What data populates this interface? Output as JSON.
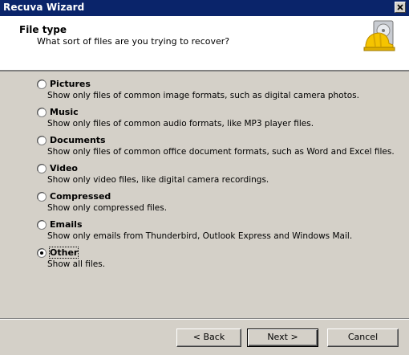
{
  "window": {
    "title": "Recuva Wizard"
  },
  "header": {
    "title": "File type",
    "subtitle": "What sort of files are you trying to recover?"
  },
  "options": [
    {
      "label": "Pictures",
      "desc": "Show only files of common image formats, such as digital camera photos.",
      "selected": false
    },
    {
      "label": "Music",
      "desc": "Show only files of common audio formats, like MP3 player files.",
      "selected": false
    },
    {
      "label": "Documents",
      "desc": "Show only files of common office document formats, such as Word and Excel files.",
      "selected": false
    },
    {
      "label": "Video",
      "desc": "Show only video files, like digital camera recordings.",
      "selected": false
    },
    {
      "label": "Compressed",
      "desc": "Show only compressed files.",
      "selected": false
    },
    {
      "label": "Emails",
      "desc": "Show only emails from Thunderbird, Outlook Express and Windows Mail.",
      "selected": false
    },
    {
      "label": "Other",
      "desc": "Show all files.",
      "selected": true
    }
  ],
  "buttons": {
    "back": "< Back",
    "next": "Next >",
    "cancel": "Cancel"
  }
}
